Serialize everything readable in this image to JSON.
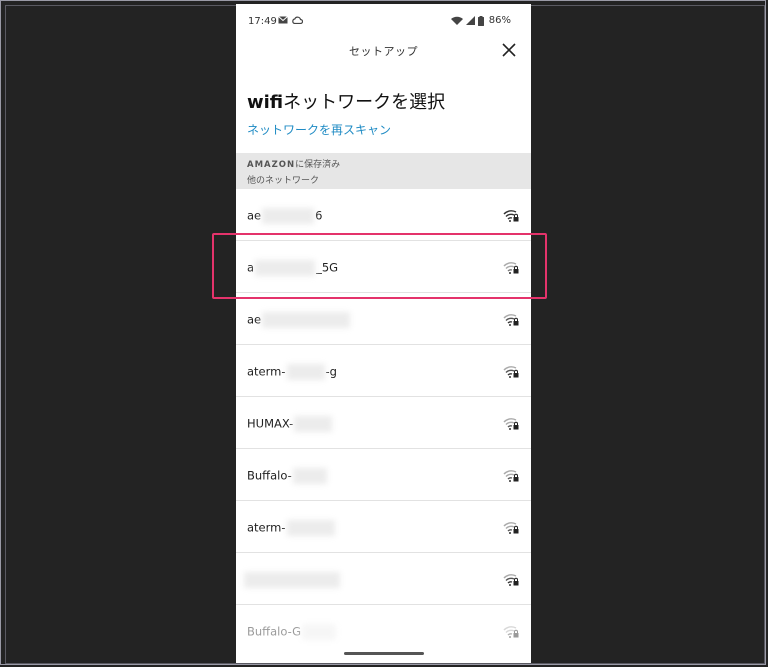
{
  "status_bar": {
    "time": "17:49",
    "battery": "86%",
    "icons_left": [
      "mail-icon",
      "cloud-icon"
    ],
    "icons_right": [
      "wifi-icon",
      "signal-icon",
      "battery-icon"
    ]
  },
  "header": {
    "title": "セットアップ",
    "close_icon": "close-icon"
  },
  "page": {
    "title_bold": "wifi",
    "title_rest": "ネットワークを選択",
    "rescan_label": "ネットワークを再スキャン"
  },
  "section": {
    "saved_caps": "AMAZON",
    "saved_rest": "に保存済み",
    "other_label": "他のネットワーク"
  },
  "networks": [
    {
      "prefix": "ae",
      "suffix": "6"
    },
    {
      "prefix": "a",
      "suffix": "_5G"
    },
    {
      "prefix": "ae",
      "suffix": ""
    },
    {
      "prefix": "aterm-",
      "suffix": "-g"
    },
    {
      "prefix": "HUMAX-",
      "suffix": ""
    },
    {
      "prefix": "Buffalo-",
      "suffix": ""
    },
    {
      "prefix": "aterm-",
      "suffix": ""
    },
    {
      "prefix": "",
      "suffix": ""
    },
    {
      "prefix": "Buffalo-G",
      "suffix": ""
    }
  ],
  "colors": {
    "accent": "#1f8bc4",
    "highlight": "#e4336b"
  }
}
